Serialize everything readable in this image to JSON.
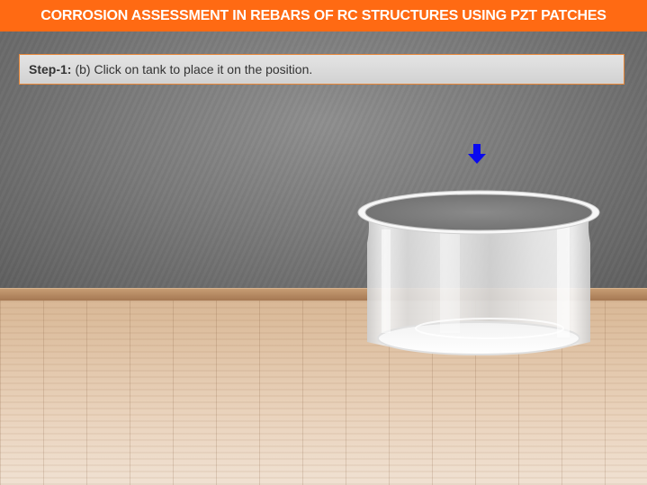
{
  "header": {
    "title": "CORROSION ASSESSMENT IN REBARS OF RC STRUCTURES USING PZT PATCHES"
  },
  "instruction": {
    "step_label": "Step-1:",
    "text": "(b) Click on tank to place it on the position."
  },
  "pointer": {
    "icon": "arrow-down-icon",
    "color": "#0a0aef"
  },
  "tank": {
    "icon": "glass-tank"
  },
  "colors": {
    "accent": "#ff6a13",
    "instruction_border": "#e8883a"
  }
}
